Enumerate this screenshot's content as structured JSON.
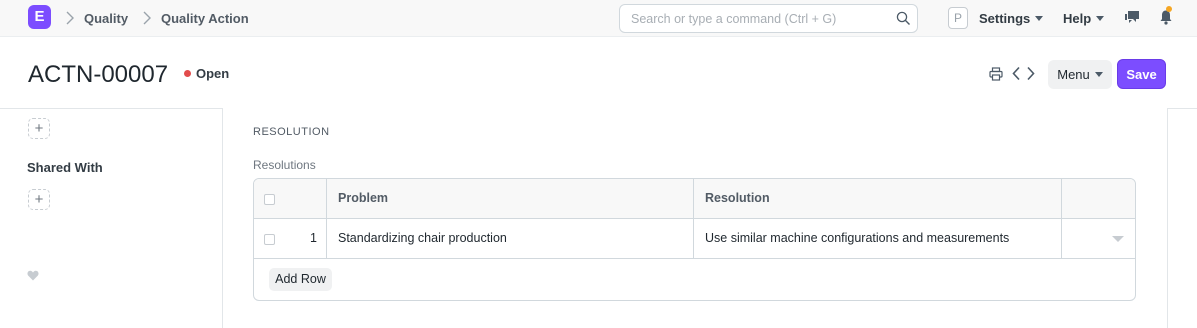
{
  "navbar": {
    "logo_letter": "E",
    "breadcrumbs": [
      "Quality",
      "Quality Action"
    ],
    "search_placeholder": "Search or type a command (Ctrl + G)",
    "avatar_letter": "P",
    "settings_label": "Settings",
    "help_label": "Help",
    "icons": [
      "search-icon",
      "chat-icon",
      "bell-icon"
    ]
  },
  "page": {
    "title": "ACTN-00007",
    "status": "Open",
    "status_color": "#e24c4c",
    "menu_label": "Menu",
    "save_label": "Save",
    "accent_color": "#7c4dff"
  },
  "sidebar": {
    "shared_with_label": "Shared With",
    "add_symbol": "+"
  },
  "form": {
    "section_title": "RESOLUTION",
    "field_label": "Resolutions",
    "table": {
      "columns": [
        "Problem",
        "Resolution"
      ],
      "rows": [
        {
          "index": "1",
          "problem": "Standardizing chair production",
          "resolution": "Use similar machine configurations and measurements"
        }
      ]
    },
    "add_row_label": "Add Row"
  }
}
